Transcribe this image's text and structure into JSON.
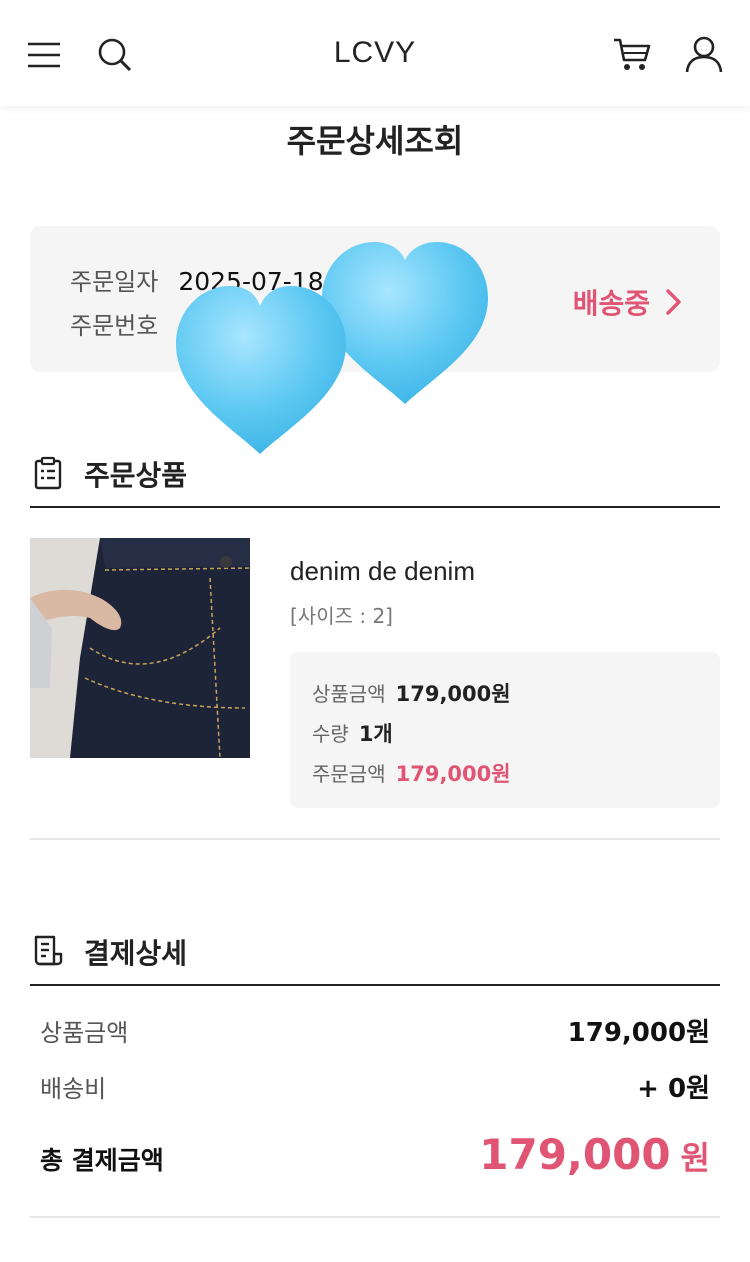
{
  "header": {
    "brand": "LCVY",
    "icons": [
      "menu-icon",
      "search-icon",
      "cart-icon",
      "user-icon"
    ]
  },
  "page_title": "주문상세조회",
  "order": {
    "date_label": "주문일자",
    "date_value": "2025-07-18",
    "number_label": "주문번호",
    "status": "배송중"
  },
  "products_section": {
    "title": "주문상품",
    "icon": "clipboard-icon",
    "item": {
      "name": "denim de denim",
      "option": "[사이즈 : 2]",
      "price_label": "상품금액",
      "price_value": "179,000원",
      "qty_label": "수량",
      "qty_value": "1개",
      "order_amount_label": "주문금액",
      "order_amount_value": "179,000원"
    }
  },
  "payment_section": {
    "title": "결제상세",
    "icon": "receipt-icon",
    "rows": [
      {
        "label": "상품금액",
        "value": "179,000원"
      },
      {
        "label": "배송비",
        "value": "+ 0원"
      }
    ],
    "total_label": "총 결제금액",
    "total_value": "179,000",
    "total_unit": "원"
  },
  "colors": {
    "accent": "#e05574",
    "box_bg": "#f5f5f5",
    "heart": "#6fd0f5"
  }
}
